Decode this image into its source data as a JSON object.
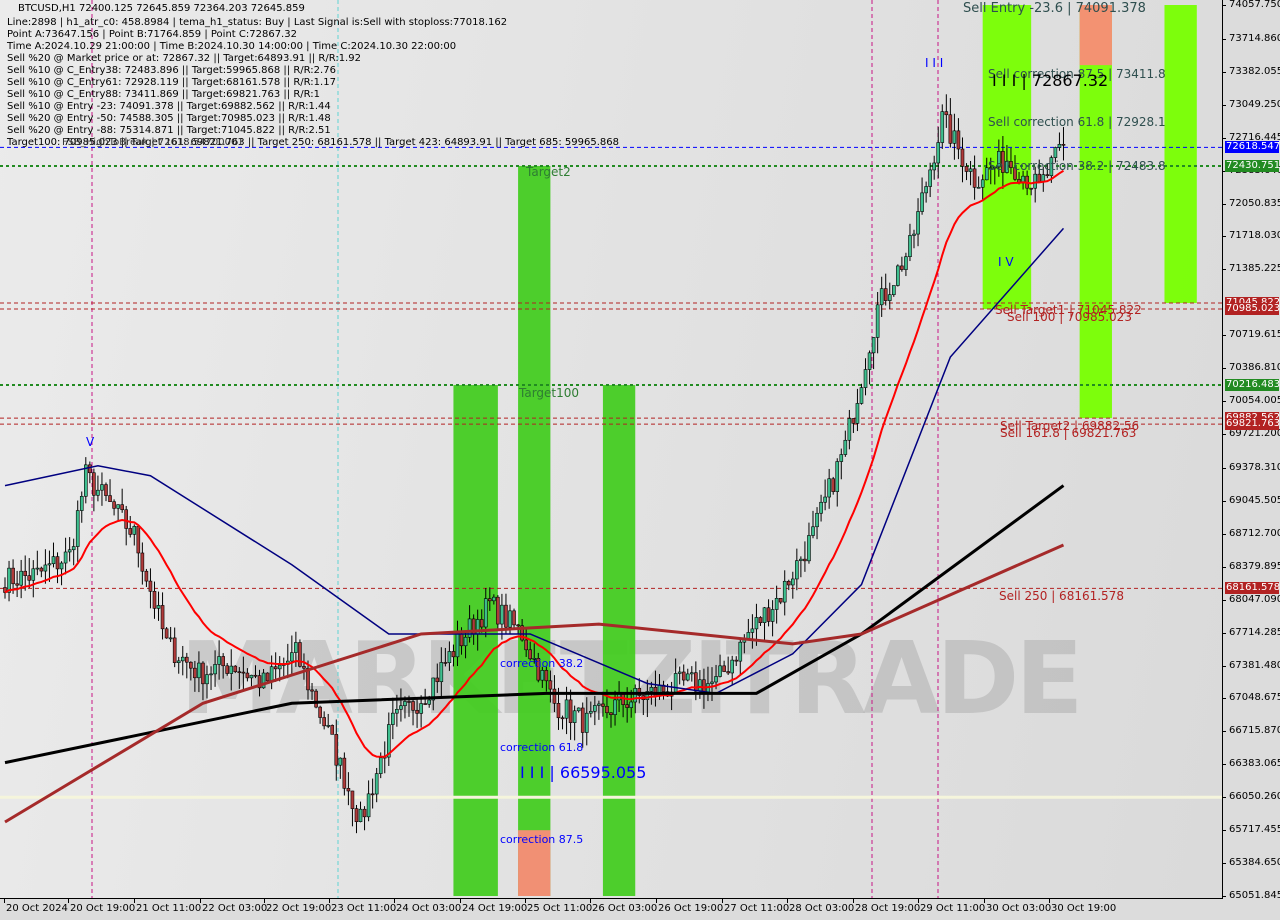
{
  "header": {
    "title": "BTCUSD,H1  72400.125 72645.859 72364.203 72645.859",
    "lines": [
      "Line:2898 | h1_atr_c0: 458.8984 | tema_h1_status: Buy | Last Signal is:Sell with stoploss:77018.162",
      "Point A:73647.156 | Point B:71764.859 | Point C:72867.32",
      "Time A:2024.10.29 21:00:00 | Time B:2024.10.30 14:00:00 | Time C:2024.10.30 22:00:00",
      "Sell %20 @ Market price or at: 72867.32 || Target:64893.91 || R/R:1.92",
      "Sell %10 @ C_Entry38: 72483.896 || Target:59965.868 || R/R:2.76",
      "Sell %10 @ C_Entry61: 72928.119 || Target:68161.578 || R/R:1.17",
      "Sell %10 @ C_Entry88: 73411.869 || Target:69821.763 || R/R:1",
      "Sell %10 @ Entry -23: 74091.378 || Target:69882.562 || R/R:1.44",
      "Sell %20 @ Entry -50: 74588.305 || Target:70985.023 || R/R:1.48",
      "Sell %20 @ Entry -88: 75314.871 || Target:71045.822 || R/R:2.51",
      "Target100: 70985.023 || Target 161: 69821.763 || Target 250: 68161.578 || Target 423: 64893.91 || Target 685: 59965.868"
    ],
    "overlap_text": "FSB_HighToBreak | 72618.54700001"
  },
  "annotations": {
    "sell_entry": "Sell Entry -23.6 | 74091.378",
    "sell_corr_875": "Sell correction 87.5 | 73411.8",
    "point_c": "I I I | 72867.32",
    "sell_corr_618": "Sell correction 61.8 | 72928.1",
    "sell_corr_382": "Sell correction 38.2 | 72483.8",
    "sell_target1": "Sell Target1 | 71045.822",
    "sell_100": "Sell 100 | 70985.023",
    "sell_target2": "Sell Target2 | 69882.56",
    "sell_1618": "Sell 161.8 | 69821.763",
    "sell_250": "Sell 250 | 68161.578",
    "target2": "Target2",
    "target1": "Target100",
    "corr_382": "correction 38.2",
    "corr_618": "correction 61.8",
    "low_mark": "I I I | 66595.055",
    "corr_875": "correction 87.5",
    "wave_iii": "I I I",
    "wave_iv": "I V",
    "wave_v": "V"
  },
  "watermark": "MARKETZITRADE",
  "price_axis": {
    "ticks": [
      "74057.750",
      "73714.860",
      "73382.055",
      "73049.250",
      "72716.445",
      "72383.640",
      "72050.835",
      "71718.030",
      "71385.225",
      "70719.615",
      "70386.810",
      "70054.005",
      "69721.200",
      "69378.310",
      "69045.505",
      "68712.700",
      "68379.895",
      "68047.090",
      "67714.285",
      "67381.480",
      "67048.675",
      "66715.870",
      "66383.065",
      "66050.260",
      "65717.455",
      "65384.650",
      "65051.845"
    ],
    "tags": [
      {
        "text": "72618.547",
        "color": "#0000ff"
      },
      {
        "text": "72430.751",
        "color": "#228b22"
      },
      {
        "text": "71045.822",
        "color": "#b22222"
      },
      {
        "text": "70985.023",
        "color": "#b22222"
      },
      {
        "text": "70216.483",
        "color": "#228b22"
      },
      {
        "text": "69882.562",
        "color": "#b22222"
      },
      {
        "text": "69821.763",
        "color": "#b22222"
      },
      {
        "text": "68161.578",
        "color": "#b22222"
      }
    ]
  },
  "time_axis": {
    "labels": [
      "20 Oct 2024",
      "20 Oct 19:00",
      "21 Oct 11:00",
      "22 Oct 03:00",
      "22 Oct 19:00",
      "23 Oct 11:00",
      "24 Oct 03:00",
      "24 Oct 19:00",
      "25 Oct 11:00",
      "26 Oct 03:00",
      "26 Oct 19:00",
      "27 Oct 11:00",
      "28 Oct 03:00",
      "28 Oct 19:00",
      "29 Oct 11:00",
      "30 Oct 03:00",
      "30 Oct 19:00"
    ]
  },
  "colors": {
    "bull": "#3fbf8f",
    "bear": "#b03a3a",
    "zone_green": "#44cc22",
    "zone_lime": "#77ff00",
    "zone_red": "#fa8c78",
    "ma_fast": "#ff0000",
    "ma_blue": "#000080",
    "ma_black": "#000000",
    "ma_brown": "#a52a2a"
  },
  "chart_data": {
    "type": "candlestick",
    "symbol": "BTCUSD",
    "timeframe": "H1",
    "ylim": [
      65051.845,
      74057.75
    ],
    "close_keypoints": [
      [
        "2024.10.20 00:00",
        68250
      ],
      [
        "2024.10.20 08:00",
        68300
      ],
      [
        "2024.10.20 16:00",
        68500
      ],
      [
        "2024.10.20 20:00",
        69300
      ],
      [
        "2024.10.21 00:00",
        69100
      ],
      [
        "2024.10.21 08:00",
        68700
      ],
      [
        "2024.10.21 16:00",
        67600
      ],
      [
        "2024.10.22 00:00",
        67300
      ],
      [
        "2024.10.22 08:00",
        67400
      ],
      [
        "2024.10.22 16:00",
        67200
      ],
      [
        "2024.10.23 00:00",
        67500
      ],
      [
        "2024.10.23 08:00",
        66700
      ],
      [
        "2024.10.23 16:00",
        65800
      ],
      [
        "2024.10.24 00:00",
        66800
      ],
      [
        "2024.10.24 08:00",
        67100
      ],
      [
        "2024.10.24 16:00",
        67600
      ],
      [
        "2024.10.25 00:00",
        68000
      ],
      [
        "2024.10.25 08:00",
        67700
      ],
      [
        "2024.10.25 16:00",
        67000
      ],
      [
        "2024.10.26 00:00",
        66800
      ],
      [
        "2024.10.26 08:00",
        67000
      ],
      [
        "2024.10.26 16:00",
        67100
      ],
      [
        "2024.10.27 00:00",
        67200
      ],
      [
        "2024.10.27 08:00",
        67200
      ],
      [
        "2024.10.27 16:00",
        67700
      ],
      [
        "2024.10.28 00:00",
        68100
      ],
      [
        "2024.10.28 08:00",
        68700
      ],
      [
        "2024.10.28 16:00",
        69600
      ],
      [
        "2024.10.29 00:00",
        71000
      ],
      [
        "2024.10.29 08:00",
        71600
      ],
      [
        "2024.10.29 16:00",
        72900
      ],
      [
        "2024.10.30 00:00",
        72300
      ],
      [
        "2024.10.30 08:00",
        72500
      ],
      [
        "2024.10.30 16:00",
        72200
      ],
      [
        "2024.10.30 22:00",
        72645.859
      ]
    ],
    "ma_series": [
      {
        "key": "ma_blue",
        "points": [
          [
            "2024.10.20 00:00",
            69200
          ],
          [
            "2024.10.20 23:00",
            69400
          ],
          [
            "2024.10.21 12:00",
            69300
          ],
          [
            "2024.10.22 23:00",
            68400
          ],
          [
            "2024.10.23 23:00",
            67700
          ],
          [
            "2024.10.25 10:00",
            67700
          ],
          [
            "2024.10.26 15:00",
            67200
          ],
          [
            "2024.10.27 08:00",
            67100
          ],
          [
            "2024.10.28 03:00",
            67500
          ],
          [
            "2024.10.28 20:00",
            68200
          ],
          [
            "2024.10.29 18:00",
            70500
          ],
          [
            "2024.10.30 22:00",
            71800
          ]
        ]
      },
      {
        "key": "ma_black",
        "points": [
          [
            "2024.10.20 00:00",
            66400
          ],
          [
            "2024.10.22 23:00",
            67000
          ],
          [
            "2024.10.25 14:00",
            67100
          ],
          [
            "2024.10.27 18:00",
            67100
          ],
          [
            "2024.10.28 20:00",
            67700
          ],
          [
            "2024.10.30 22:00",
            69200
          ]
        ]
      },
      {
        "key": "ma_brown",
        "points": [
          [
            "2024.10.20 00:00",
            65800
          ],
          [
            "2024.10.22 01:00",
            67000
          ],
          [
            "2024.10.24 07:00",
            67700
          ],
          [
            "2024.10.26 03:00",
            67800
          ],
          [
            "2024.10.28 03:00",
            67600
          ],
          [
            "2024.10.28 20:00",
            67700
          ],
          [
            "2024.10.30 22:00",
            68600
          ]
        ]
      }
    ],
    "levels": [
      {
        "price": 72618.547,
        "color": "#0000ff",
        "style": "dash"
      },
      {
        "price": 72430.751,
        "color": "#228b22",
        "style": "dot"
      },
      {
        "price": 71045.822,
        "color": "#b22222",
        "style": "dash"
      },
      {
        "price": 70985.023,
        "color": "#b22222",
        "style": "dash"
      },
      {
        "price": 70216.483,
        "color": "#228b22",
        "style": "dot"
      },
      {
        "price": 69882.562,
        "color": "#b22222",
        "style": "dash"
      },
      {
        "price": 69821.763,
        "color": "#b22222",
        "style": "dash"
      },
      {
        "price": 68161.578,
        "color": "#b22222",
        "style": "dash"
      },
      {
        "price": 66050.26,
        "color": "#f5f5dc",
        "style": "solid"
      }
    ],
    "zones": [
      {
        "from": "2024.10.24 15:00",
        "to": "2024.10.25 02:00",
        "top": 70216.483,
        "bottom": 65051.845,
        "color": "zone_green"
      },
      {
        "from": "2024.10.25 07:00",
        "to": "2024.10.25 15:00",
        "top": 72430.751,
        "bottom": 65051.845,
        "color": "zone_green"
      },
      {
        "from": "2024.10.25 07:00",
        "to": "2024.10.25 15:00",
        "top": 65717,
        "bottom": 65051.845,
        "color": "zone_red"
      },
      {
        "from": "2024.10.26 04:00",
        "to": "2024.10.26 12:00",
        "top": 70216.483,
        "bottom": 65051.845,
        "color": "zone_green"
      },
      {
        "from": "2024.10.30 02:00",
        "to": "2024.10.30 14:00",
        "top": 74057.75,
        "bottom": 70985.023,
        "color": "zone_lime"
      },
      {
        "from": "2024.10.31 02:00",
        "to": "2024.10.31 10:00",
        "top": 74057.75,
        "bottom": 69882.562,
        "color": "zone_lime"
      },
      {
        "from": "2024.10.31 02:00",
        "to": "2024.10.31 10:00",
        "top": 74057.75,
        "bottom": 73450,
        "color": "zone_red"
      },
      {
        "from": "2024.10.31 23:00",
        "to": "2024.11.01 07:00",
        "top": 74057.75,
        "bottom": 71045.822,
        "color": "zone_lime"
      }
    ]
  }
}
